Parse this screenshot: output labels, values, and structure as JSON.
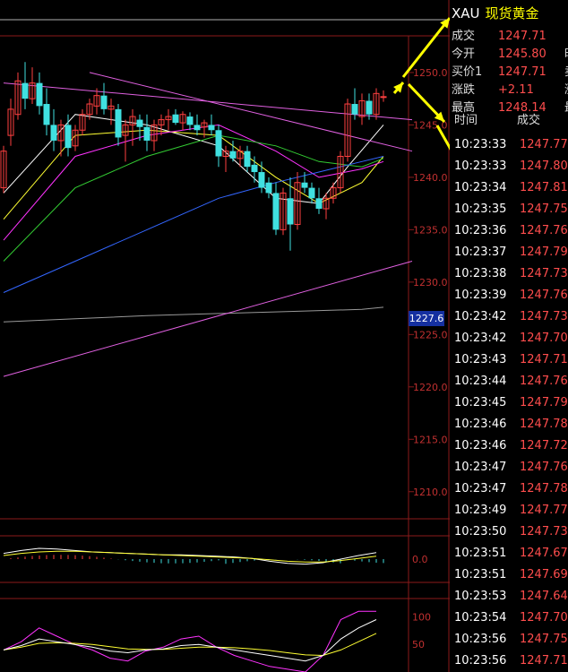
{
  "quote": {
    "symbol": "XAU",
    "name": "现货黄金",
    "rows": [
      {
        "label": "成交",
        "value": "1247.71",
        "extra": ""
      },
      {
        "label": "今开",
        "value": "1245.80",
        "extra": "时"
      },
      {
        "label": "买价1",
        "value": "1247.71",
        "extra": "卖"
      },
      {
        "label": "涨跌",
        "value": "+2.11",
        "extra": "涨"
      },
      {
        "label": "最高",
        "value": "1248.14",
        "extra": "最"
      }
    ]
  },
  "ticks_header": {
    "time": "时间",
    "price": "成交"
  },
  "ticks": [
    {
      "time": "10:23:33",
      "price": "1247.77"
    },
    {
      "time": "10:23:33",
      "price": "1247.80"
    },
    {
      "time": "10:23:34",
      "price": "1247.81"
    },
    {
      "time": "10:23:35",
      "price": "1247.75"
    },
    {
      "time": "10:23:36",
      "price": "1247.76"
    },
    {
      "time": "10:23:37",
      "price": "1247.79"
    },
    {
      "time": "10:23:38",
      "price": "1247.73"
    },
    {
      "time": "10:23:39",
      "price": "1247.76"
    },
    {
      "time": "10:23:42",
      "price": "1247.73"
    },
    {
      "time": "10:23:42",
      "price": "1247.70"
    },
    {
      "time": "10:23:43",
      "price": "1247.71"
    },
    {
      "time": "10:23:44",
      "price": "1247.76"
    },
    {
      "time": "10:23:45",
      "price": "1247.79"
    },
    {
      "time": "10:23:46",
      "price": "1247.78"
    },
    {
      "time": "10:23:46",
      "price": "1247.72"
    },
    {
      "time": "10:23:47",
      "price": "1247.76"
    },
    {
      "time": "10:23:47",
      "price": "1247.78"
    },
    {
      "time": "10:23:49",
      "price": "1247.77"
    },
    {
      "time": "10:23:50",
      "price": "1247.73"
    },
    {
      "time": "10:23:51",
      "price": "1247.67"
    },
    {
      "time": "10:23:51",
      "price": "1247.69"
    },
    {
      "time": "10:23:53",
      "price": "1247.64"
    },
    {
      "time": "10:23:54",
      "price": "1247.70"
    },
    {
      "time": "10:23:56",
      "price": "1247.75"
    },
    {
      "time": "10:23:56",
      "price": "1247.71"
    }
  ],
  "current_price_tag": "1227.6",
  "chart_data": {
    "type": "candlestick",
    "yticks": [
      1250,
      1245,
      1240,
      1235,
      1230,
      1225,
      1220,
      1215,
      1210
    ],
    "ytick_labels": [
      "1250.0",
      "1245.0",
      "1240.0",
      "1235.0",
      "1230.0",
      "1225.0",
      "1220.0",
      "1215.0",
      "1210.0"
    ],
    "ylim": [
      1207.5,
      1253.5
    ],
    "n_slots": 57,
    "candles": [
      {
        "i": 0,
        "o": 1239.0,
        "h": 1243.0,
        "l": 1238.5,
        "c": 1242.5
      },
      {
        "i": 1,
        "o": 1244.0,
        "h": 1247.5,
        "l": 1243.0,
        "c": 1246.5
      },
      {
        "i": 2,
        "o": 1246.0,
        "h": 1250.0,
        "l": 1245.5,
        "c": 1249.2
      },
      {
        "i": 3,
        "o": 1249.0,
        "h": 1251.0,
        "l": 1246.5,
        "c": 1247.5
      },
      {
        "i": 4,
        "o": 1247.5,
        "h": 1250.5,
        "l": 1247.0,
        "c": 1249.0
      },
      {
        "i": 5,
        "o": 1249.0,
        "h": 1250.0,
        "l": 1246.0,
        "c": 1246.8
      },
      {
        "i": 6,
        "o": 1247.0,
        "h": 1248.5,
        "l": 1244.0,
        "c": 1245.0
      },
      {
        "i": 7,
        "o": 1245.0,
        "h": 1246.5,
        "l": 1242.5,
        "c": 1243.5
      },
      {
        "i": 8,
        "o": 1243.5,
        "h": 1245.5,
        "l": 1242.0,
        "c": 1245.0
      },
      {
        "i": 9,
        "o": 1245.0,
        "h": 1246.0,
        "l": 1242.0,
        "c": 1242.8
      },
      {
        "i": 10,
        "o": 1243.0,
        "h": 1245.0,
        "l": 1242.5,
        "c": 1244.5
      },
      {
        "i": 11,
        "o": 1244.5,
        "h": 1246.5,
        "l": 1244.0,
        "c": 1246.0
      },
      {
        "i": 12,
        "o": 1246.0,
        "h": 1247.5,
        "l": 1245.5,
        "c": 1247.0
      },
      {
        "i": 13,
        "o": 1246.8,
        "h": 1248.5,
        "l": 1246.0,
        "c": 1247.8
      },
      {
        "i": 14,
        "o": 1247.8,
        "h": 1249.0,
        "l": 1246.0,
        "c": 1246.5
      },
      {
        "i": 15,
        "o": 1246.5,
        "h": 1247.5,
        "l": 1245.0,
        "c": 1246.8
      },
      {
        "i": 16,
        "o": 1246.5,
        "h": 1247.0,
        "l": 1243.0,
        "c": 1243.8
      },
      {
        "i": 17,
        "o": 1244.0,
        "h": 1245.5,
        "l": 1241.5,
        "c": 1245.0
      },
      {
        "i": 18,
        "o": 1245.0,
        "h": 1246.5,
        "l": 1243.0,
        "c": 1245.8
      },
      {
        "i": 19,
        "o": 1245.5,
        "h": 1246.0,
        "l": 1243.5,
        "c": 1244.8
      },
      {
        "i": 20,
        "o": 1244.8,
        "h": 1246.0,
        "l": 1242.5,
        "c": 1243.5
      },
      {
        "i": 21,
        "o": 1243.5,
        "h": 1245.5,
        "l": 1242.5,
        "c": 1245.0
      },
      {
        "i": 22,
        "o": 1245.0,
        "h": 1246.0,
        "l": 1244.0,
        "c": 1245.5
      },
      {
        "i": 23,
        "o": 1245.5,
        "h": 1246.5,
        "l": 1244.5,
        "c": 1245.8
      },
      {
        "i": 24,
        "o": 1246.0,
        "h": 1246.5,
        "l": 1245.0,
        "c": 1245.2
      },
      {
        "i": 25,
        "o": 1245.2,
        "h": 1246.3,
        "l": 1244.5,
        "c": 1246.0
      },
      {
        "i": 26,
        "o": 1245.8,
        "h": 1246.2,
        "l": 1244.5,
        "c": 1245.0
      },
      {
        "i": 27,
        "o": 1245.0,
        "h": 1246.0,
        "l": 1244.0,
        "c": 1244.5
      },
      {
        "i": 28,
        "o": 1244.8,
        "h": 1245.5,
        "l": 1243.8,
        "c": 1245.2
      },
      {
        "i": 29,
        "o": 1245.0,
        "h": 1246.0,
        "l": 1244.0,
        "c": 1244.5
      },
      {
        "i": 30,
        "o": 1244.5,
        "h": 1245.0,
        "l": 1241.0,
        "c": 1242.0
      },
      {
        "i": 31,
        "o": 1242.0,
        "h": 1243.0,
        "l": 1240.5,
        "c": 1242.5
      },
      {
        "i": 32,
        "o": 1242.5,
        "h": 1243.5,
        "l": 1241.5,
        "c": 1241.8
      },
      {
        "i": 33,
        "o": 1241.8,
        "h": 1243.0,
        "l": 1241.0,
        "c": 1242.5
      },
      {
        "i": 34,
        "o": 1242.5,
        "h": 1243.0,
        "l": 1240.5,
        "c": 1241.0
      },
      {
        "i": 35,
        "o": 1241.2,
        "h": 1242.0,
        "l": 1239.5,
        "c": 1240.5
      },
      {
        "i": 36,
        "o": 1240.5,
        "h": 1241.5,
        "l": 1238.5,
        "c": 1239.0
      },
      {
        "i": 37,
        "o": 1239.5,
        "h": 1240.0,
        "l": 1238.0,
        "c": 1238.5
      },
      {
        "i": 38,
        "o": 1238.5,
        "h": 1239.5,
        "l": 1234.5,
        "c": 1235.0
      },
      {
        "i": 39,
        "o": 1235.0,
        "h": 1239.0,
        "l": 1234.5,
        "c": 1238.5
      },
      {
        "i": 40,
        "o": 1238.0,
        "h": 1240.0,
        "l": 1233.0,
        "c": 1235.5
      },
      {
        "i": 41,
        "o": 1235.5,
        "h": 1240.5,
        "l": 1235.0,
        "c": 1239.5
      },
      {
        "i": 42,
        "o": 1239.5,
        "h": 1240.5,
        "l": 1238.5,
        "c": 1239.0
      },
      {
        "i": 43,
        "o": 1239.0,
        "h": 1239.5,
        "l": 1237.5,
        "c": 1238.0
      },
      {
        "i": 44,
        "o": 1238.0,
        "h": 1239.0,
        "l": 1236.5,
        "c": 1237.0
      },
      {
        "i": 45,
        "o": 1237.0,
        "h": 1238.5,
        "l": 1236.0,
        "c": 1238.0
      },
      {
        "i": 46,
        "o": 1238.0,
        "h": 1239.5,
        "l": 1237.5,
        "c": 1239.0
      },
      {
        "i": 47,
        "o": 1239.0,
        "h": 1242.5,
        "l": 1238.5,
        "c": 1242.0
      },
      {
        "i": 48,
        "o": 1242.0,
        "h": 1247.5,
        "l": 1241.5,
        "c": 1247.0
      },
      {
        "i": 49,
        "o": 1247.0,
        "h": 1248.5,
        "l": 1245.5,
        "c": 1246.0
      },
      {
        "i": 50,
        "o": 1245.8,
        "h": 1248.0,
        "l": 1245.0,
        "c": 1247.3
      },
      {
        "i": 51,
        "o": 1247.3,
        "h": 1248.0,
        "l": 1245.5,
        "c": 1246.0
      },
      {
        "i": 52,
        "o": 1246.0,
        "h": 1248.5,
        "l": 1245.5,
        "c": 1248.0
      },
      {
        "i": 53,
        "o": 1247.7,
        "h": 1248.3,
        "l": 1247.2,
        "c": 1247.7
      }
    ],
    "overlays": [
      {
        "color": "#ffffff",
        "slot": [
          0,
          10,
          20,
          30,
          38,
          44,
          48,
          53
        ],
        "values": [
          1238.5,
          1246.0,
          1245.0,
          1243.0,
          1238.0,
          1237.5,
          1241.0,
          1245.0
        ]
      },
      {
        "color": "#ffff33",
        "slot": [
          0,
          10,
          20,
          30,
          38,
          44,
          50,
          53
        ],
        "values": [
          1236.0,
          1244.0,
          1244.5,
          1244.0,
          1240.0,
          1237.5,
          1239.5,
          1242.0
        ]
      },
      {
        "color": "#ff33ff",
        "slot": [
          0,
          10,
          20,
          30,
          38,
          44,
          50,
          53
        ],
        "values": [
          1234.0,
          1242.0,
          1244.0,
          1245.0,
          1242.5,
          1240.0,
          1240.8,
          1241.5
        ]
      },
      {
        "color": "#33cc33",
        "slot": [
          0,
          10,
          20,
          30,
          38,
          44,
          50,
          53
        ],
        "values": [
          1232.0,
          1239.0,
          1242.0,
          1244.0,
          1243.0,
          1241.5,
          1241.0,
          1241.8
        ]
      },
      {
        "color": "#3366ff",
        "slot": [
          0,
          10,
          20,
          30,
          38,
          44,
          50,
          53
        ],
        "values": [
          1229.0,
          1232.0,
          1235.0,
          1238.0,
          1239.5,
          1240.5,
          1241.5,
          1242.0
        ]
      },
      {
        "color": "#999999",
        "slot": [
          0,
          10,
          20,
          30,
          40,
          50,
          53
        ],
        "values": [
          1226.2,
          1226.5,
          1226.8,
          1227.0,
          1227.2,
          1227.4,
          1227.6
        ]
      },
      {
        "color": "#e060e0",
        "slot": [
          0,
          57
        ],
        "values": [
          1221.0,
          1232.0
        ]
      },
      {
        "color": "#e060e0",
        "slot": [
          0,
          57
        ],
        "values": [
          1249.0,
          1245.5
        ]
      },
      {
        "color": "#e060e0",
        "slot": [
          12,
          57
        ],
        "values": [
          1250.0,
          1242.5
        ]
      }
    ],
    "macd": {
      "ytick_labels": [
        "0.0"
      ],
      "ylim": [
        -3,
        3
      ],
      "dif": [
        0.8,
        1.2,
        1.5,
        1.4,
        1.2,
        1.0,
        0.9,
        0.8,
        0.7,
        0.6,
        0.6,
        0.5,
        0.4,
        0.3,
        0.1,
        -0.3,
        -0.6,
        -0.7,
        -0.5,
        0.0,
        0.5,
        0.9
      ],
      "dea": [
        0.5,
        0.8,
        1.0,
        1.1,
        1.1,
        1.0,
        0.9,
        0.8,
        0.7,
        0.6,
        0.5,
        0.4,
        0.3,
        0.2,
        0.1,
        -0.1,
        -0.3,
        -0.4,
        -0.4,
        -0.2,
        0.1,
        0.4
      ],
      "hist_slot_end": 53
    },
    "kdj": {
      "ytick_labels": [
        "100",
        "50"
      ],
      "ylim": [
        0,
        130
      ],
      "k": [
        40,
        48,
        60,
        55,
        50,
        45,
        38,
        35,
        40,
        42,
        48,
        50,
        45,
        40,
        35,
        30,
        25,
        20,
        30,
        60,
        80,
        95
      ],
      "d": [
        40,
        45,
        52,
        53,
        52,
        50,
        46,
        42,
        41,
        41,
        43,
        45,
        45,
        44,
        42,
        39,
        35,
        31,
        30,
        40,
        55,
        70
      ],
      "j": [
        40,
        55,
        80,
        65,
        50,
        40,
        25,
        20,
        38,
        45,
        60,
        65,
        45,
        30,
        20,
        10,
        5,
        0,
        30,
        95,
        110,
        110
      ]
    }
  }
}
